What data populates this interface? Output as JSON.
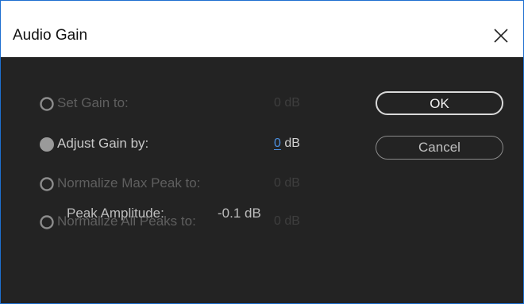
{
  "window": {
    "title": "Audio Gain"
  },
  "options": [
    {
      "label": "Set Gain to:",
      "value": "0",
      "unit": "dB",
      "selected": false,
      "enabled": true
    },
    {
      "label": "Adjust Gain by:",
      "value": "0",
      "unit": "dB",
      "selected": true,
      "enabled": true
    },
    {
      "label": "Normalize Max Peak to:",
      "value": "0",
      "unit": "dB",
      "selected": false,
      "enabled": true
    },
    {
      "label": "Normalize All Peaks to:",
      "value": "0",
      "unit": "dB",
      "selected": false,
      "enabled": true
    }
  ],
  "buttons": {
    "ok_label": "OK",
    "cancel_label": "Cancel"
  },
  "peak": {
    "label": "Peak Amplitude:",
    "value": "-0.1 dB"
  },
  "colors": {
    "accent": "#4b8fe0",
    "background": "#232323",
    "window_border": "#1e6fd0"
  },
  "icons": {
    "close": "close-icon",
    "radio_unselected": "radio-unselected-icon",
    "radio_selected": "radio-selected-icon"
  }
}
